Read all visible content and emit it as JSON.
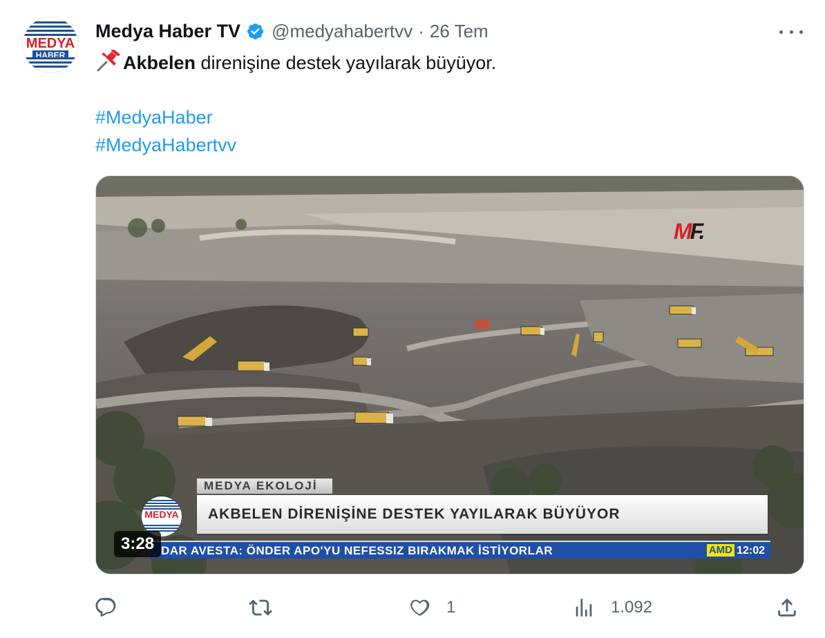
{
  "tweet": {
    "author_name": "Medya Haber TV",
    "handle": "@medyahabertvv",
    "separator": "·",
    "date": "26 Tem",
    "text_bold": "Akbelen",
    "text_rest": " direnişine destek yayılarak büyüyor.",
    "hashtags": [
      "#MedyaHaber",
      "#MedyaHabertvv"
    ],
    "avatar": {
      "line1": "MEDYA",
      "line2": "HABER"
    }
  },
  "video": {
    "lower_third_tag": "MEDYA EKOLOJİ",
    "lower_third_title": "AKBELEN DİRENİŞİNE DESTEK YAYILARAK BÜYÜYOR",
    "ticker_text": "DAR AVESTA: ÖNDER APO'YU NEFESSIZ BIRAKMAK İSTİYORLAR",
    "ticker_badge": "AMD",
    "ticker_time": "12:02",
    "channel_logo_text": "MEDYA",
    "corner_logo_m": "M",
    "corner_logo_f": "F.",
    "duration": "3:28"
  },
  "actions": {
    "reply_count": "",
    "retweet_count": "",
    "like_count": "1",
    "views_count": "1.092"
  },
  "icons": {
    "verified": "verified-badge-icon",
    "pin": "pushpin-emoji-icon",
    "more": "more-options-icon",
    "reply": "reply-icon",
    "retweet": "retweet-icon",
    "like": "heart-icon",
    "views": "views-icon",
    "share": "share-icon"
  },
  "colors": {
    "link": "#1d9bf0",
    "secondary_text": "#536471",
    "verified": "#1d9bf0",
    "ticker_bg": "#1f4fa6"
  }
}
